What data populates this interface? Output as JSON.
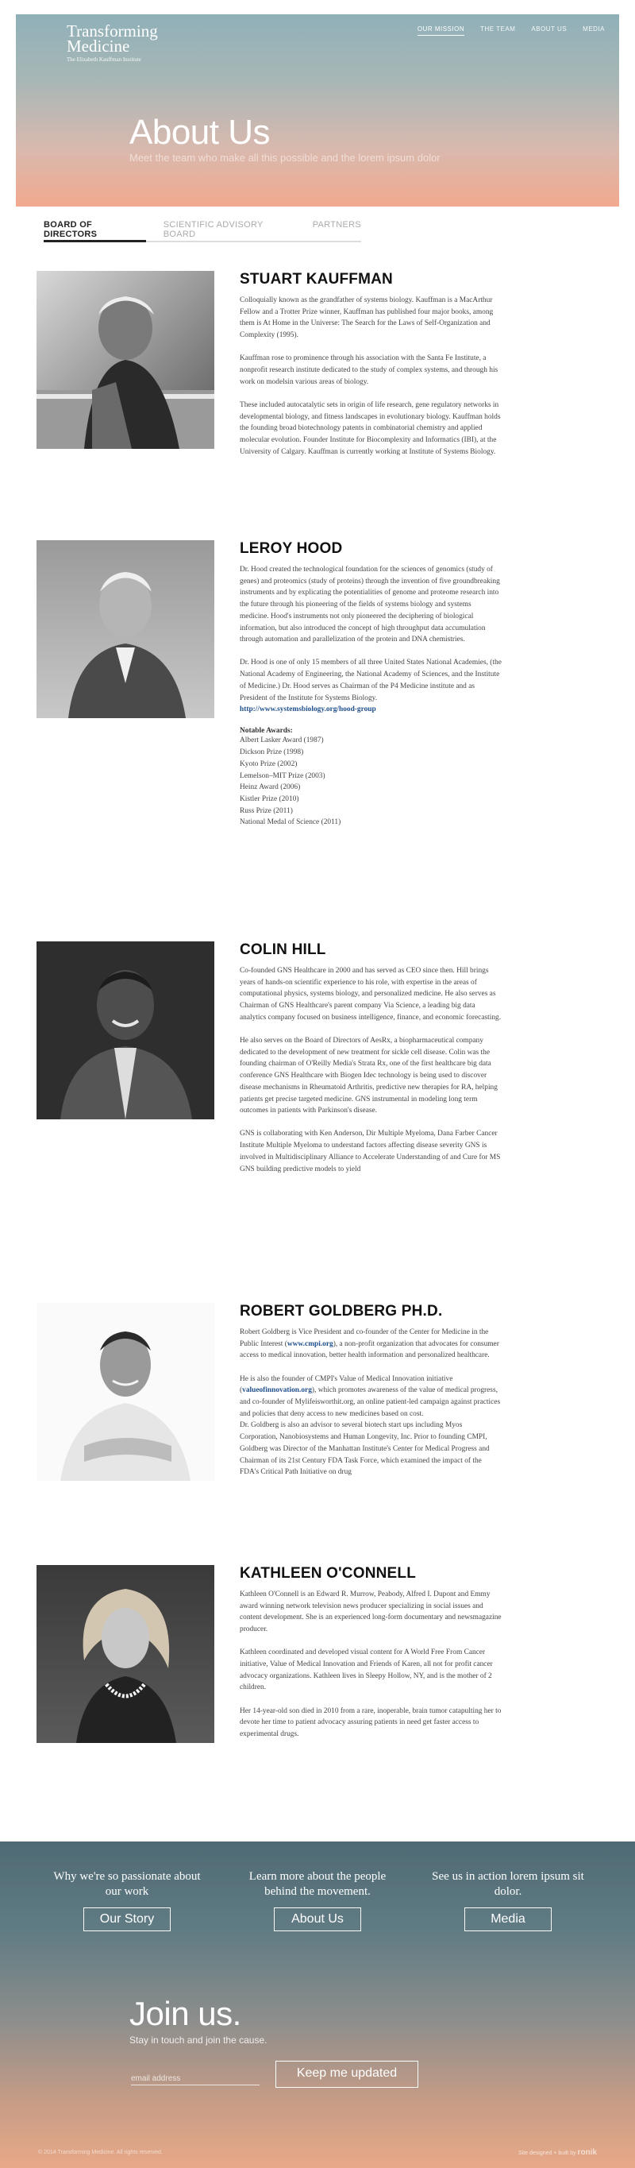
{
  "site": {
    "logo_line1": "Transforming",
    "logo_line2": "Medicine",
    "logo_line3": "The Elizabeth Kauffman Institute"
  },
  "nav": [
    {
      "label": "OUR MISSION",
      "active": true
    },
    {
      "label": "THE TEAM",
      "active": false
    },
    {
      "label": "ABOUT US",
      "active": false
    },
    {
      "label": "MEDIA",
      "active": false
    }
  ],
  "hero": {
    "title": "About Us",
    "tagline": "Meet the team who make all this possible and the lorem ipsum dolor"
  },
  "tabs": [
    {
      "label": "BOARD OF DIRECTORS",
      "active": true
    },
    {
      "label": "SCIENTIFIC ADVISORY BOARD",
      "active": false
    },
    {
      "label": "PARTNERS",
      "active": false
    }
  ],
  "members": [
    {
      "name": "STUART KAUFFMAN",
      "paragraphs": [
        "Colloquially known as the grandfather of systems biology. Kauffman is a MacArthur Fellow and a Trotter Prize winner, Kauffman has published four major books, among them is At Home in the Universe: The Search for the Laws of Self-Organization and Complexity (1995).",
        "Kauffman rose to prominence through his association with the Santa Fe Institute, a nonprofit research institute dedicated to the study of complex systems, and through his work on modelsin various areas of biology.",
        "These included autocatalytic sets in origin of life research, gene regulatory networks in developmental biology, and fitness landscapes in evolutionary biology. Kauffman holds the founding broad biotechnology patents in combinatorial chemistry and applied molecular evolution. Founder Institute for Biocomplexity and Informatics (IBI), at the University of Calgary. Kauffman is currently working at Institute of Systems Biology."
      ]
    },
    {
      "name": "LEROY HOOD",
      "paragraphs": [
        "Dr. Hood created the technological foundation for the sciences of genomics (study of genes) and proteomics (study of proteins) through the invention of five groundbreaking instruments and by explicating the potentialities of genome and proteome research into the future through his pioneering of the fields of systems biology and systems medicine. Hood's instruments not only pioneered the deciphering of biological information, but also introduced the concept of high throughput data accumulation through automation and parallelization of the protein and DNA chemistries.",
        "Dr. Hood is one of only 15 members of all three United States National Academies, (the National Academy of Engineering, the National Academy of Sciences, and the Institute of Medicine.) Dr. Hood serves as Chairman of the P4 Medicine institute and as President of the Institute for Systems Biology."
      ],
      "link": "http://www.systemsbiology.org/hood-group",
      "awards_title": "Notable Awards:",
      "awards": [
        "Albert Lasker Award (1987)",
        "Dickson Prize (1998)",
        "Kyoto Prize (2002)",
        "Lemelson–MIT Prize (2003)",
        "Heinz Award (2006)",
        "Kistler Prize (2010)",
        "Russ Prize (2011)",
        "National Medal of Science (2011)"
      ]
    },
    {
      "name": "COLIN HILL",
      "paragraphs": [
        "Co-founded GNS Healthcare in 2000 and has served as CEO since then. Hill brings years of hands-on scientific experience to his role, with expertise in the areas of computational physics, systems biology, and personalized medicine. He also serves as Chairman of GNS Healthcare's parent company Via Science, a leading big data analytics company focused on business intelligence, finance, and economic forecasting.",
        "He also serves on the Board of Directors of AesRx, a biopharmaceutical company dedicated to the development of new treatment for sickle cell disease. Colin was the founding chairman of O'Reilly Media's Strata Rx, one of the first healthcare big data conference GNS Healthcare with Biogen Idec technology is being used to discover disease mechanisms in Rheumatoid Arthritis, predictive new therapies for RA, helping patients get precise targeted medicine. GNS instrumental in modeling long term outcomes in patients with Parkinson's disease.",
        "GNS is collaborating with Ken Anderson, Dir Multiple Myeloma, Dana Farber Cancer Institute Multiple Myeloma to understand factors affecting disease severity GNS is involved in Multidisciplinary Alliance to Accelerate Understanding of and Cure for MS GNS building predictive models to yield"
      ]
    },
    {
      "name": "ROBERT GOLDBERG PH.D.",
      "p1_a": "Robert Goldberg is Vice President and co-founder of the Center for Medicine in the Public Interest (",
      "p1_link": "www.cmpi.org",
      "p1_b": "), a non-profit organization that advocates for consumer access to medical innovation, better health information and personalized healthcare.",
      "p2_a": "He is also the founder of CMPI's Value of Medical Innovation initiative (",
      "p2_link": "valueofinnovation.org",
      "p2_b": "), which promotes awareness of the value of medical progress, and co-founder of Mylifeisworthit.org, an online patient-led campaign against practices and policies that deny access to new medicines based on cost.",
      "p3": "Dr. Goldberg is also an advisor to several biotech start ups including Myos Corporation, Nanobiosystems and Human Longevity, Inc. Prior to founding CMPI, Goldberg was Director of the Manhattan Institute's Center for Medical Progress and Chairman of its 21st Century FDA Task Force, which examined the impact of the FDA's Critical Path Initiative on drug"
    },
    {
      "name": "KATHLEEN O'CONNELL",
      "paragraphs": [
        "Kathleen O'Connell is an Edward R. Murrow, Peabody, Alfred I. Dupont and Emmy award winning network television news producer specializing in social issues and content development. She is an experienced long-form documentary and newsmagazine producer.",
        "Kathleen coordinated and developed visual content for A World Free From Cancer initiative, Value of Medical Innovation and Friends of Karen, all not for profit cancer advocacy organizations. Kathleen lives in Sleepy Hollow, NY, and is the mother of 2 children.",
        "Her 14-year-old son died in 2010 from a rare, inoperable, brain tumor catapulting her to devote her time to patient advocacy assuring patients in need get faster access to experimental drugs."
      ]
    }
  ],
  "cta": {
    "cols": [
      {
        "text": "Why we're so passionate about our work",
        "button": "Our Story"
      },
      {
        "text": "Learn more about the people behind the movement.",
        "button": "About Us"
      },
      {
        "text": "See us in action lorem ipsum sit dolor.",
        "button": "Media"
      }
    ],
    "join_title": "Join us.",
    "join_sub": "Stay in touch and join the cause.",
    "email_placeholder": "email address",
    "keep_button": "Keep me updated",
    "copyright": "© 2014 Transforming Medicine. All rights reserved.",
    "credit_text": "Site designed + built by",
    "credit_brand": "ronik"
  }
}
